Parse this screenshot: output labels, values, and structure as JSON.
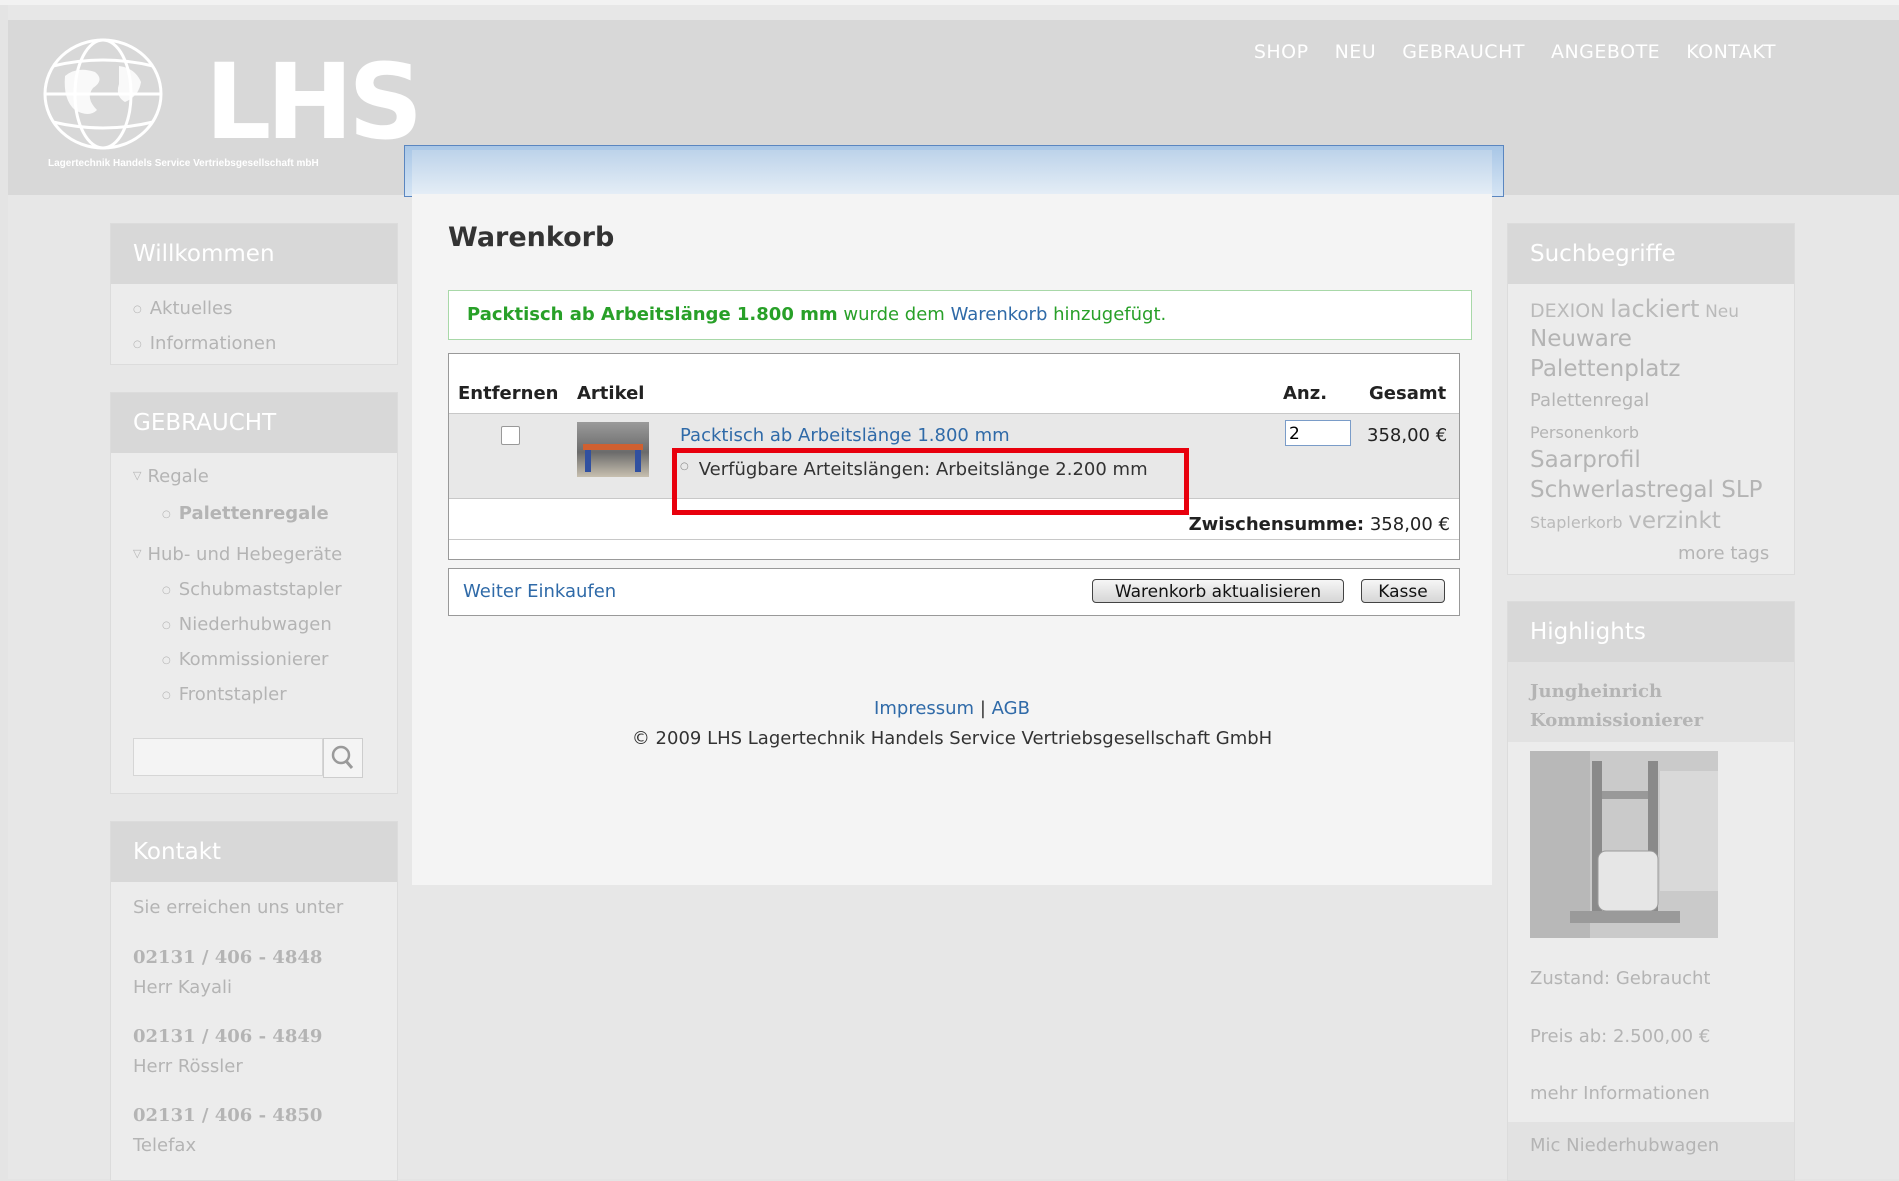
{
  "header": {
    "logo_text": "LHS",
    "logo_subtitle": "Lagertechnik Handels Service Vertriebsgesellschaft mbH",
    "nav": [
      "SHOP",
      "NEU",
      "GEBRAUCHT",
      "ANGEBOTE",
      "KONTAKT"
    ]
  },
  "left": {
    "welcome": {
      "title": "Willkommen",
      "items": [
        "Aktuelles",
        "Informationen"
      ]
    },
    "used": {
      "title": "GEBRAUCHT",
      "regale": "Regale",
      "palettenregale": "Palettenregale",
      "hub": "Hub- und Hebegeräte",
      "hub_items": [
        "Schubmaststapler",
        "Niederhubwagen",
        "Kommissionierer",
        "Frontstapler"
      ]
    },
    "contact": {
      "title": "Kontakt",
      "intro": "Sie erreichen uns unter",
      "entries": [
        {
          "phone": "02131 / 406 - 4848",
          "name": "Herr Kayali"
        },
        {
          "phone": "02131 / 406 - 4849",
          "name": "Herr Rössler"
        },
        {
          "phone": "02131 / 406 - 4850",
          "name": "Telefax"
        }
      ]
    }
  },
  "cart": {
    "title": "Warenkorb",
    "message": {
      "product": "Packtisch ab Arbeitslänge 1.800 mm",
      "text1": "wurde dem",
      "link": "Warenkorb",
      "text2": "hinzugefügt."
    },
    "headers": {
      "remove": "Entfernen",
      "item": "Artikel",
      "qty": "Anz.",
      "total": "Gesamt"
    },
    "item": {
      "name": "Packtisch ab Arbeitslänge 1.800 mm",
      "option": "Verfügbare Arteitslängen: Arbeitslänge 2.200 mm",
      "qty": "2",
      "total": "358,00 €"
    },
    "subtotal_label": "Zwischensumme:",
    "subtotal_value": "358,00 €",
    "continue": "Weiter Einkaufen",
    "update": "Warenkorb aktualisieren",
    "checkout": "Kasse"
  },
  "footer": {
    "impressum": "Impressum",
    "separator": "|",
    "agb": "AGB",
    "copyright": "© 2009 LHS Lagertechnik Handels Service Vertriebsgesellschaft GmbH"
  },
  "right": {
    "tags": {
      "title": "Suchbegriffe",
      "dexion": "DEXION",
      "lackiert": "lackiert",
      "neu": "Neu",
      "neuware": "Neuware",
      "palettenplatz": "Palettenplatz",
      "palettenregal": "Palettenregal",
      "personenkorb": "Personenkorb",
      "saarprofil": "Saarprofil",
      "schwerlast": "Schwerlastregal SLP",
      "staplerkorb": "Staplerkorb",
      "verzinkt": "verzinkt",
      "more": "more tags"
    },
    "highlights": {
      "title": "Highlights",
      "product": "Jungheinrich Kommissionierer",
      "zustand": "Zustand: Gebraucht",
      "preis": "Preis ab: 2.500,00 €",
      "mehr": "mehr Informationen",
      "next": "Mic Niederhubwagen"
    }
  }
}
